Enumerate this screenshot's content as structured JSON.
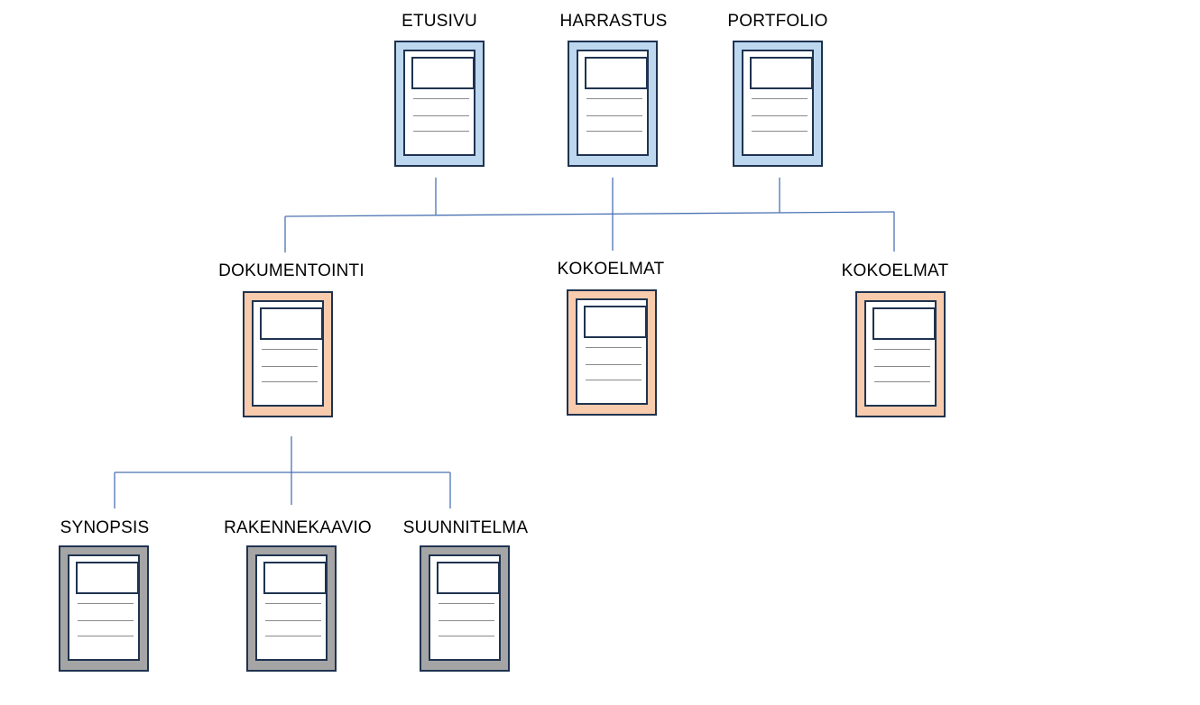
{
  "colors": {
    "top": "#bdd7ee",
    "middle": "#f8cbad",
    "bottom": "#a5a5a5",
    "connector": "#4a72b2",
    "border": "#1f3350"
  },
  "labels": {
    "etusivu": "ETUSIVU",
    "harrastus": "HARRASTUS",
    "portfolio": "PORTFOLIO",
    "dokumentointi": "DOKUMENTOINTI",
    "kokoelmat_1": "KOKOELMAT",
    "kokoelmat_2": "KOKOELMAT",
    "synopsis": "SYNOPSIS",
    "rakennekaavio": "RAKENNEKAAVIO",
    "suunnitelma": "SUUNNITELMA"
  }
}
